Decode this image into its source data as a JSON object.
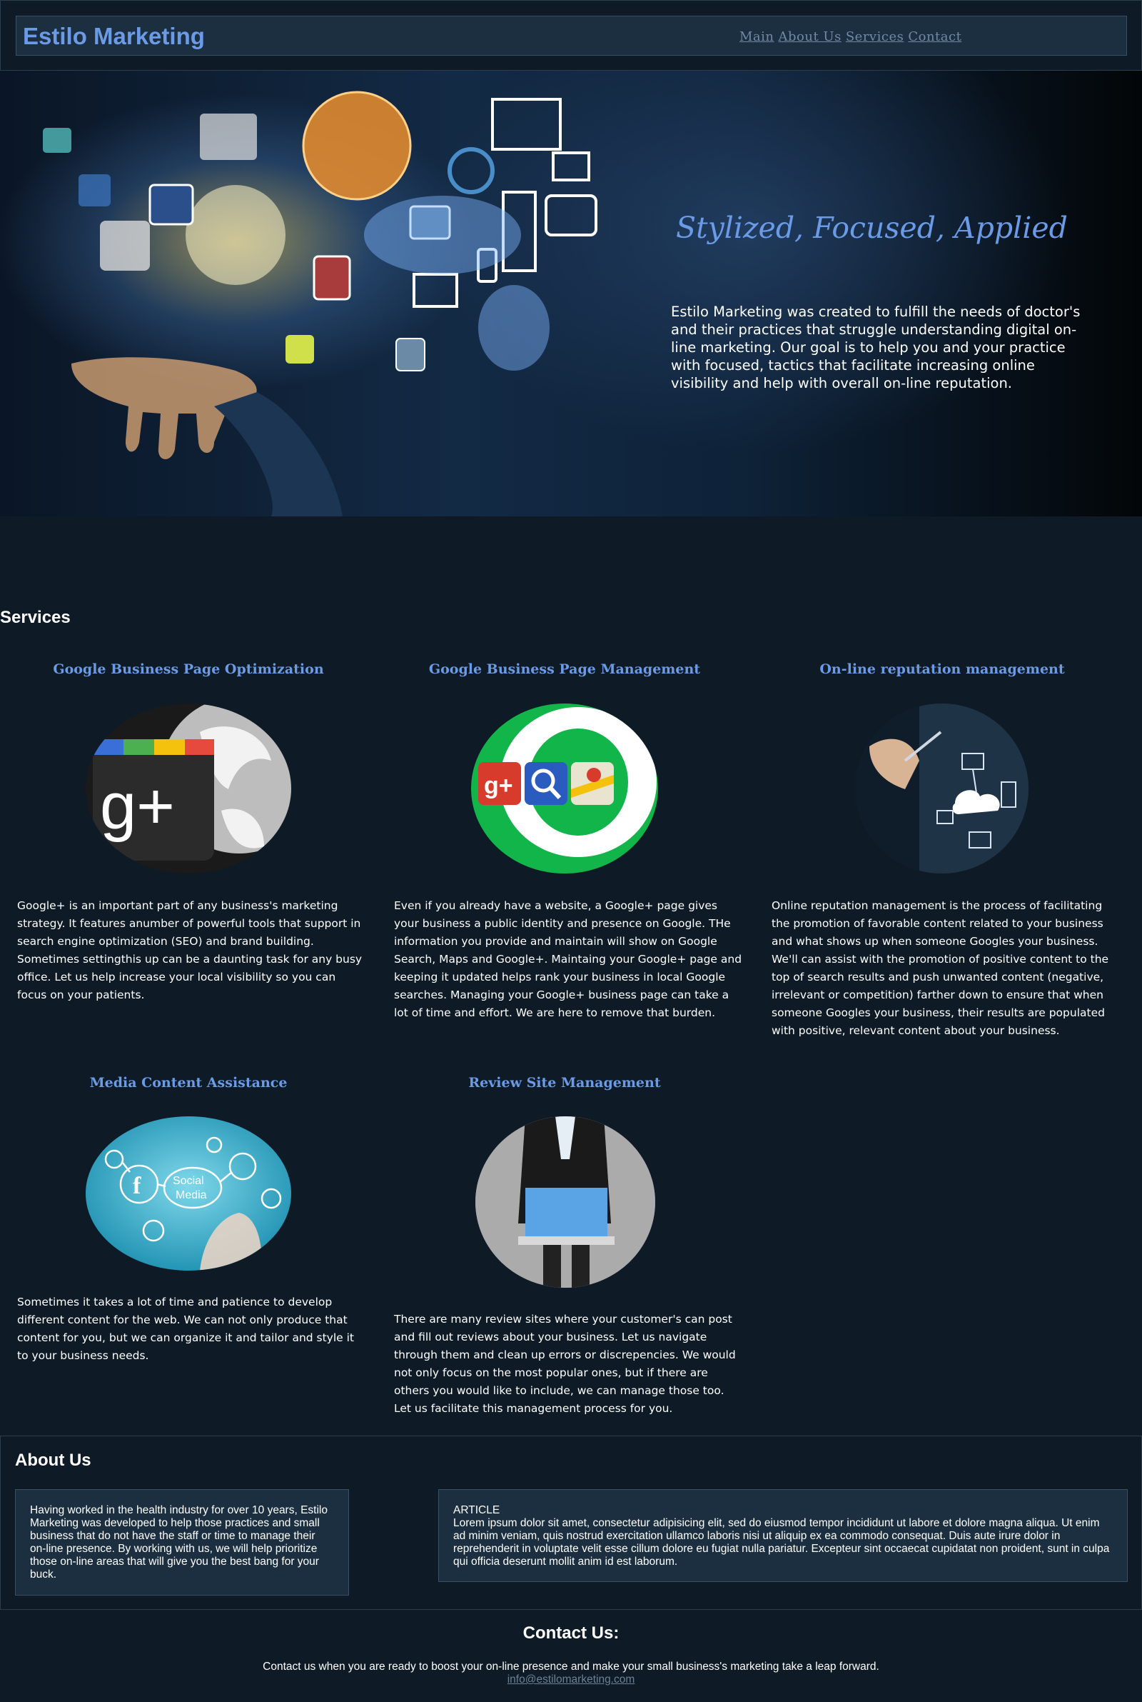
{
  "header": {
    "brand": "Estilo Marketing",
    "nav": [
      "Main",
      "About Us",
      "Services",
      "Contact"
    ]
  },
  "hero": {
    "title": "Stylized, Focused, Applied",
    "text": "Estilo Marketing was created to fulfill the needs of doctor's and their practices that struggle understanding digital on-line marketing. Our goal is to help you and your practice with focused, tactics that facilitate increasing online visibility and help with overall on-line reputation."
  },
  "services": {
    "heading": "Services",
    "items": [
      {
        "title": "Google Business Page Optimization",
        "image": "google-plus-globe-image",
        "text": "Google+ is an important part of any business's marketing strategy. It features anumber of powerful tools that support in search engine optimization (SEO) and brand building. Sometimes settingthis up can be a daunting task for any busy office. Let us help increase your local visibility so you can focus on your patients."
      },
      {
        "title": "Google Business Page Management",
        "image": "google-apps-icons-image",
        "text": "Even if you already have a website, a Google+ page gives your business a public identity and presence on Google. THe information you provide and maintain will show on Google Search, Maps and Google+. Maintaing your Google+ page and keeping it updated helps rank your business in local Google searches. Managing your Google+ business page can take a lot of time and effort. We are here to remove that burden."
      },
      {
        "title": "On-line reputation management",
        "image": "hand-drawing-cloud-diagram-image",
        "text": "Online reputation management is the process of facilitating the promotion of favorable content related to your business and what shows up when someone Googles your business. We'll can assist with the promotion of positive content to the top of search results and push unwanted content (negative, irrelevant or competition) farther down to ensure that when someone Googles your business, their results are populated with positive, relevant content about your business."
      },
      {
        "title": "Media Content Assistance",
        "image": "social-media-network-image",
        "text": "Sometimes it takes a lot of time and patience to develop different content for the web. We can not only produce that content for you, but we can organize it and tailor and style it to your business needs."
      },
      {
        "title": "Review Site Management",
        "image": "businessman-laptop-image",
        "text": "There are many review sites where your customer's can post and fill out reviews about your business. Let us navigate through them and clean up errors or discrepencies. We would not only focus on the most popular ones, but if there are others you would like to include, we can manage those too. Let us facilitate this management process for you."
      }
    ]
  },
  "about": {
    "heading": "About Us",
    "left_text": "Having worked in the health industry for over 10 years, Estilo Marketing was developed to help those practices and small business that do not have the staff or time to manage their on-line presence. By working with us, we will help prioritize those on-line areas that will give you the best bang for your buck.",
    "article_label": "ARTICLE",
    "article_text": "Lorem ipsum dolor sit amet, consectetur adipisicing elit, sed do eiusmod tempor incididunt ut labore et dolore magna aliqua. Ut enim ad minim veniam, quis nostrud exercitation ullamco laboris nisi ut aliquip ex ea commodo consequat. Duis aute irure dolor in reprehenderit in voluptate velit esse cillum dolore eu fugiat nulla pariatur. Excepteur sint occaecat cupidatat non proident, sunt in culpa qui officia deserunt mollit anim id est laborum."
  },
  "contact": {
    "heading": "Contact Us:",
    "text": "Contact us when you are ready to boost your on-line presence and make your small business's marketing take a leap forward.",
    "email": "info@estilomarketing.com"
  },
  "colors": {
    "background": "#0e1b26",
    "panel": "#1b2f40",
    "accent": "#6b9be6",
    "nav_link": "#7289a3"
  }
}
